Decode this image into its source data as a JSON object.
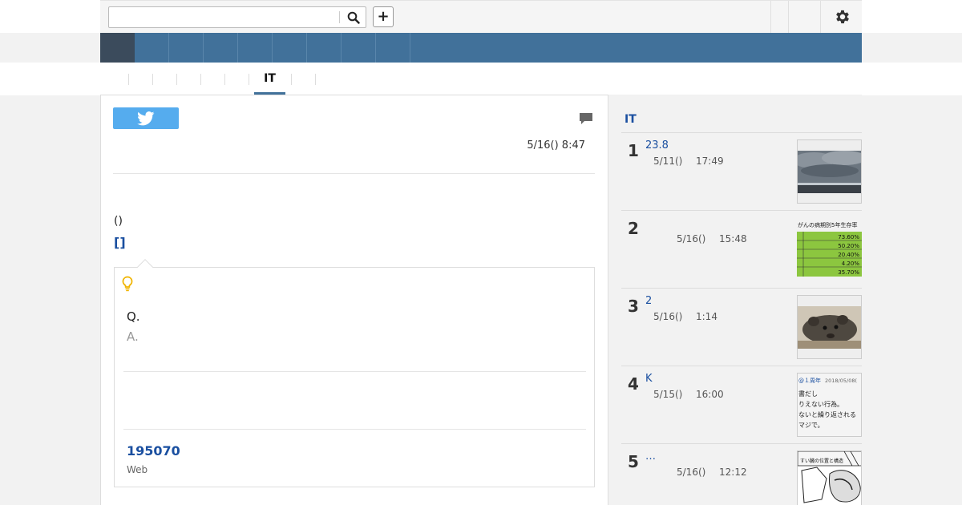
{
  "search": {
    "value": "",
    "placeholder": ""
  },
  "toolbar": {
    "add_label": "+"
  },
  "subnav": {
    "active_tab": "IT"
  },
  "article": {
    "datetime": "5/16() 8:47",
    "paren_text": "()",
    "bracket_link": "[]",
    "qa": {
      "q": "Q.",
      "a": "A."
    },
    "count_link": "195070",
    "source_label": "Web"
  },
  "sidebar": {
    "title": "IT",
    "ranking": [
      {
        "rank": "1",
        "title": "23.8",
        "date": "5/11()",
        "time": "17:49",
        "thumb": "clouds"
      },
      {
        "rank": "2",
        "title": "",
        "date": "5/16()",
        "time": "15:48",
        "thumb": "table"
      },
      {
        "rank": "3",
        "title": "2",
        "date": "5/16()",
        "time": "1:14",
        "thumb": "animal"
      },
      {
        "rank": "4",
        "title": "K",
        "date": "5/15()",
        "time": "16:00",
        "thumb": "text"
      },
      {
        "rank": "5",
        "title": "…",
        "date": "5/16()",
        "time": "12:12",
        "thumb": "manga"
      }
    ]
  },
  "thumb_text": {
    "table_header": "がんの病期別5年生存率",
    "table_values": [
      "73.60%",
      "50.20%",
      "20.40%",
      "4.20%",
      "35.70%"
    ],
    "tweet_handle": "@１周年",
    "tweet_date": "2018/05/08(",
    "tweet_lines": [
      "書だし",
      "りえない行為。",
      "ないと繰り返される",
      "マジで。"
    ],
    "manga_label": "すい臓の位置と構造"
  },
  "colors": {
    "nav": "#41719a",
    "nav_active": "#3b4b5c",
    "link": "#1a4fa0",
    "twitter": "#55acee"
  }
}
